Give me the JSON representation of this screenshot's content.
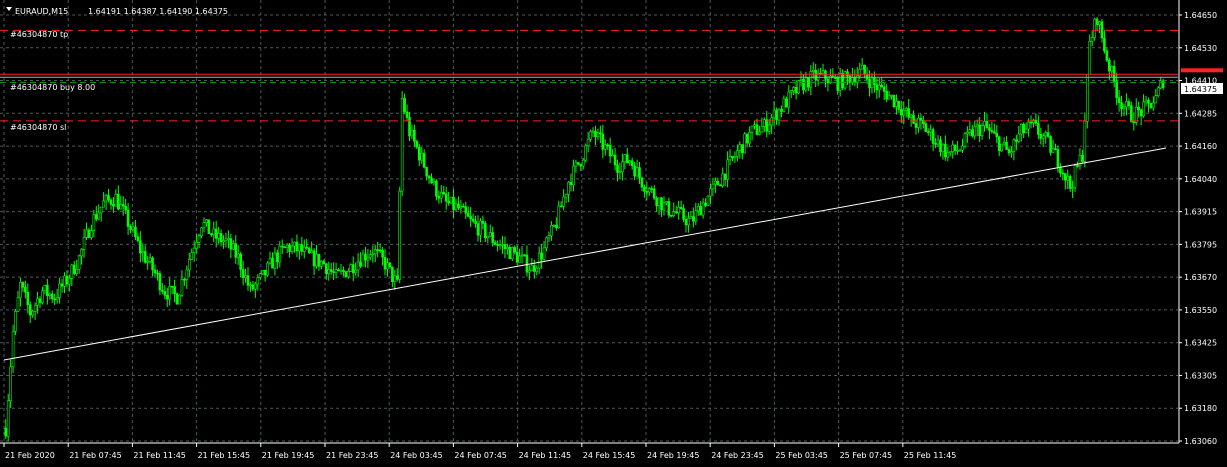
{
  "header": {
    "symbol": "EURAUD,M15",
    "ohlc": "1.64191 1.64387 1.64190 1.64375"
  },
  "colors": {
    "background": "#000000",
    "grid": "#4a5a5a",
    "candle": "#00ff00",
    "price_text": "#ffffff",
    "tp_sl_line": "#ff2020",
    "entry_line": "#00aa00",
    "trendline": "#ffffff",
    "current_price_box": "#ffffff"
  },
  "order_labels": [
    {
      "text": "#46304870 tp",
      "price": 1.6455
    },
    {
      "text": "#46304870 buy 8.00",
      "price": 1.6439
    },
    {
      "text": "#46304870 sl",
      "price": 1.6422
    }
  ],
  "chart_data": {
    "type": "candlestick",
    "symbol": "EURAUD",
    "timeframe": "M15",
    "y_ticks": [
      "1.64650",
      "1.64530",
      "1.64410",
      "1.64285",
      "1.64160",
      "1.64040",
      "1.63915",
      "1.63795",
      "1.63670",
      "1.63550",
      "1.63425",
      "1.63305",
      "1.63180",
      "1.63060"
    ],
    "ylim": [
      1.6306,
      1.6465
    ],
    "x_ticks": [
      "21 Feb 2020",
      "21 Feb 07:45",
      "21 Feb 11:45",
      "21 Feb 15:45",
      "21 Feb 19:45",
      "21 Feb 23:45",
      "24 Feb 03:45",
      "24 Feb 07:45",
      "24 Feb 11:45",
      "24 Feb 15:45",
      "24 Feb 19:45",
      "24 Feb 23:45",
      "25 Feb 03:45",
      "25 Feb 07:45",
      "25 Feb 11:45"
    ],
    "current_price": "1.64375",
    "lines": {
      "take_profit": 1.6455,
      "buy_entry": 1.6439,
      "stop_loss": 1.6422,
      "current_bid": 1.64375
    },
    "trendline": {
      "start": {
        "bar": 0,
        "price": 1.634
      },
      "end": {
        "bar": 290,
        "price": 1.6416
      }
    },
    "close_path": [
      [
        0,
        1.631
      ],
      [
        3,
        1.6345
      ],
      [
        6,
        1.6362
      ],
      [
        10,
        1.6352
      ],
      [
        15,
        1.636
      ],
      [
        20,
        1.6358
      ],
      [
        25,
        1.6364
      ],
      [
        30,
        1.6372
      ],
      [
        35,
        1.6385
      ],
      [
        40,
        1.6392
      ],
      [
        45,
        1.6394
      ],
      [
        50,
        1.6385
      ],
      [
        55,
        1.6375
      ],
      [
        60,
        1.6368
      ],
      [
        65,
        1.636
      ],
      [
        70,
        1.6358
      ],
      [
        75,
        1.6372
      ],
      [
        80,
        1.6385
      ],
      [
        85,
        1.638
      ],
      [
        90,
        1.6378
      ],
      [
        95,
        1.6372
      ],
      [
        100,
        1.636
      ],
      [
        105,
        1.6365
      ],
      [
        110,
        1.6372
      ],
      [
        115,
        1.6376
      ],
      [
        120,
        1.6375
      ],
      [
        125,
        1.6372
      ],
      [
        130,
        1.637
      ],
      [
        135,
        1.6365
      ],
      [
        140,
        1.6368
      ],
      [
        145,
        1.6372
      ],
      [
        150,
        1.6375
      ],
      [
        155,
        1.637
      ],
      [
        160,
        1.6362
      ],
      [
        162,
        1.643
      ],
      [
        165,
        1.6418
      ],
      [
        170,
        1.6408
      ],
      [
        175,
        1.6398
      ],
      [
        180,
        1.6392
      ],
      [
        185,
        1.639
      ],
      [
        190,
        1.6385
      ],
      [
        195,
        1.6382
      ],
      [
        200,
        1.6378
      ],
      [
        205,
        1.6375
      ],
      [
        210,
        1.6372
      ],
      [
        215,
        1.6368
      ],
      [
        220,
        1.6375
      ],
      [
        225,
        1.6385
      ],
      [
        230,
        1.64
      ],
      [
        235,
        1.6408
      ],
      [
        240,
        1.6418
      ],
      [
        245,
        1.6412
      ],
      [
        250,
        1.6406
      ],
      [
        255,
        1.6408
      ],
      [
        260,
        1.64
      ],
      [
        265,
        1.6395
      ],
      [
        270,
        1.639
      ],
      [
        275,
        1.6388
      ],
      [
        280,
        1.6385
      ],
      [
        285,
        1.6392
      ],
      [
        290,
        1.6398
      ],
      [
        295,
        1.6405
      ],
      [
        300,
        1.6412
      ],
      [
        305,
        1.6418
      ],
      [
        310,
        1.642
      ],
      [
        315,
        1.6425
      ],
      [
        320,
        1.643
      ],
      [
        325,
        1.6435
      ],
      [
        330,
        1.6438
      ],
      [
        335,
        1.6438
      ],
      [
        340,
        1.6436
      ],
      [
        345,
        1.6438
      ],
      [
        350,
        1.644
      ],
      [
        355,
        1.6435
      ],
      [
        360,
        1.6432
      ],
      [
        365,
        1.6428
      ],
      [
        370,
        1.6422
      ],
      [
        375,
        1.642
      ],
      [
        380,
        1.6415
      ],
      [
        385,
        1.641
      ],
      [
        390,
        1.6412
      ],
      [
        395,
        1.6418
      ],
      [
        400,
        1.642
      ],
      [
        405,
        1.6415
      ],
      [
        410,
        1.641
      ],
      [
        415,
        1.6418
      ],
      [
        420,
        1.642
      ],
      [
        425,
        1.6415
      ],
      [
        430,
        1.6408
      ],
      [
        435,
        1.6398
      ],
      [
        440,
        1.641
      ],
      [
        443,
        1.645
      ],
      [
        446,
        1.646
      ],
      [
        450,
        1.6445
      ],
      [
        455,
        1.643
      ],
      [
        460,
        1.6424
      ],
      [
        465,
        1.6426
      ],
      [
        470,
        1.643
      ],
      [
        473,
        1.6437
      ]
    ],
    "x_tick_bars": [
      0,
      31,
      62,
      93,
      124,
      155,
      186,
      217,
      248,
      279,
      310,
      341,
      372,
      403,
      434
    ]
  }
}
